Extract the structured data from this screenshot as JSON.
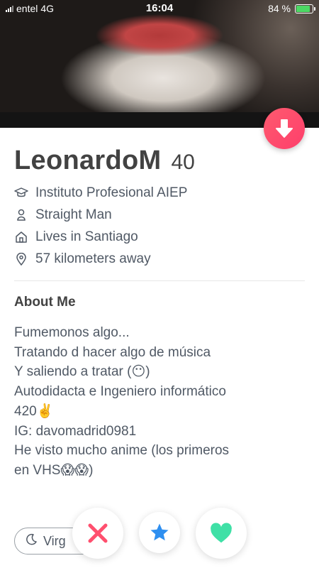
{
  "status_bar": {
    "carrier": "entel",
    "network": "4G",
    "time": "16:04",
    "battery": "84 %"
  },
  "profile": {
    "name": "LeonardoM",
    "age": "40",
    "info": [
      {
        "icon": "school-icon",
        "text": "Instituto Profesional AIEP"
      },
      {
        "icon": "person-icon",
        "text": "Straight Man"
      },
      {
        "icon": "home-icon",
        "text": "Lives in Santiago"
      },
      {
        "icon": "location-pin-icon",
        "text": "57 kilometers away"
      }
    ]
  },
  "about": {
    "title": "About Me",
    "lines": [
      "Fumemonos algo...",
      "Tratando d hacer algo de música",
      "Y saliendo a tratar (😶)",
      "Autodidacta e Ingeniero informático",
      "420✌️",
      "IG: davomadrid0981",
      "He visto mucho anime (los primeros",
      "en VHS😱😱)"
    ]
  },
  "chip": {
    "label": "Virg"
  },
  "colors": {
    "nope": "#ff4f6e",
    "star": "#2e8ff0",
    "like": "#3fe0a6",
    "down_button": "#fd4f6c"
  }
}
